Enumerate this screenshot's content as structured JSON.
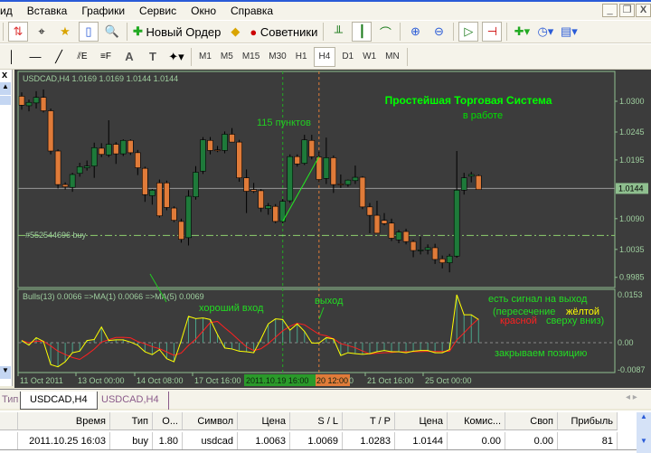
{
  "menu": [
    "ид",
    "Вставка",
    "Графики",
    "Сервис",
    "Окно",
    "Справка"
  ],
  "toolbar": {
    "new_order": "Новый Ордер",
    "experts": "Советники"
  },
  "timeframes": [
    "M1",
    "M5",
    "M15",
    "M30",
    "H1",
    "H4",
    "D1",
    "W1",
    "MN"
  ],
  "active_timeframe": "H4",
  "chart": {
    "header": "USDCAD,H4  1.0169 1.0169 1.0144 1.0144",
    "title": "Простейшая Торговая Система",
    "subtitle": "в работе",
    "points_label": "115 пунктов",
    "order_label": "#552544696 buy",
    "order_price": 1.006,
    "current_price": 1.0144,
    "price_ticks": [
      "1.0300",
      "1.0245",
      "1.0195",
      "1.0144",
      "1.0090",
      "1.0035",
      "0.9985"
    ],
    "price_tick_values": [
      1.03,
      1.0245,
      1.0195,
      1.0144,
      1.009,
      1.0035,
      0.9985
    ],
    "current_price_label": "1.0144",
    "trend_from": {
      "bar": 36,
      "price": 1.0085
    },
    "trend_to": {
      "bar": 41,
      "price": 1.0201
    },
    "entry_bar": 36,
    "exit_bar": 41,
    "candles": [
      [
        1.0309,
        1.0316,
        1.0285,
        1.0293
      ],
      [
        1.0292,
        1.0303,
        1.0282,
        1.0298
      ],
      [
        1.0297,
        1.0318,
        1.0287,
        1.0307
      ],
      [
        1.0307,
        1.0321,
        1.028,
        1.0283
      ],
      [
        1.0283,
        1.0287,
        1.0205,
        1.0211
      ],
      [
        1.0211,
        1.0214,
        1.0144,
        1.0151
      ],
      [
        1.0151,
        1.0155,
        1.0142,
        1.0147
      ],
      [
        1.0146,
        1.0172,
        1.0138,
        1.0169
      ],
      [
        1.0171,
        1.019,
        1.0165,
        1.0183
      ],
      [
        1.0181,
        1.0194,
        1.0176,
        1.0184
      ],
      [
        1.0184,
        1.0226,
        1.0163,
        1.0217
      ],
      [
        1.0216,
        1.0225,
        1.02,
        1.0205
      ],
      [
        1.0204,
        1.0266,
        1.02,
        1.0223
      ],
      [
        1.0223,
        1.0227,
        1.0188,
        1.0206
      ],
      [
        1.0206,
        1.0232,
        1.0202,
        1.023
      ],
      [
        1.023,
        1.0232,
        1.0204,
        1.0208
      ],
      [
        1.0208,
        1.0213,
        1.0168,
        1.0181
      ],
      [
        1.018,
        1.0183,
        1.012,
        1.0133
      ],
      [
        1.0131,
        1.0143,
        1.0115,
        1.0141
      ],
      [
        1.0154,
        1.016,
        1.0092,
        1.0095
      ],
      [
        1.0154,
        1.0158,
        1.0105,
        1.011
      ],
      [
        1.0109,
        1.0112,
        1.0084,
        1.0087
      ],
      [
        1.0085,
        1.009,
        1.0047,
        1.0053
      ],
      [
        1.0056,
        1.0141,
        1.0042,
        1.013
      ],
      [
        1.0129,
        1.0184,
        1.0124,
        1.0173
      ],
      [
        1.0175,
        1.0236,
        1.017,
        1.0231
      ],
      [
        1.023,
        1.0236,
        1.0205,
        1.0212
      ],
      [
        1.0213,
        1.022,
        1.0209,
        1.0212
      ],
      [
        1.0212,
        1.0246,
        1.0207,
        1.0241
      ],
      [
        1.0241,
        1.0252,
        1.023,
        1.0227
      ],
      [
        1.0227,
        1.0231,
        1.0156,
        1.0163
      ],
      [
        1.0163,
        1.0178,
        1.01,
        1.0139
      ],
      [
        1.0142,
        1.0154,
        1.0136,
        1.0139
      ],
      [
        1.014,
        1.0143,
        1.0102,
        1.0109
      ],
      [
        1.0108,
        1.0118,
        1.0097,
        1.0113
      ],
      [
        1.0112,
        1.0116,
        1.0082,
        1.0085
      ],
      [
        1.0085,
        1.0125,
        1.0082,
        1.0121
      ],
      [
        1.0122,
        1.0205,
        1.0118,
        1.0201
      ],
      [
        1.0201,
        1.0205,
        1.0183,
        1.0188
      ],
      [
        1.0189,
        1.024,
        1.0186,
        1.0231
      ],
      [
        1.023,
        1.024,
        1.0196,
        1.0201
      ],
      [
        1.02,
        1.021,
        1.0155,
        1.016
      ],
      [
        1.0162,
        1.0235,
        1.0152,
        1.0199
      ],
      [
        1.0199,
        1.0203,
        1.0136,
        1.0151
      ],
      [
        1.0152,
        1.0169,
        1.0145,
        1.0151
      ],
      [
        1.0151,
        1.016,
        1.0147,
        1.0159
      ],
      [
        1.0158,
        1.0185,
        1.0152,
        1.0164
      ],
      [
        1.0164,
        1.0166,
        1.0107,
        1.0111
      ],
      [
        1.0111,
        1.0118,
        1.0064,
        1.0096
      ],
      [
        1.0096,
        1.0122,
        1.0064,
        1.0064
      ],
      [
        1.0087,
        1.01,
        1.0078,
        1.0081
      ],
      [
        1.0082,
        1.009,
        1.005,
        1.0055
      ],
      [
        1.0052,
        1.007,
        1.0046,
        1.0066
      ],
      [
        1.0067,
        1.0072,
        1.0044,
        1.0049
      ],
      [
        1.0049,
        1.0052,
        1.0021,
        1.0033
      ],
      [
        1.0034,
        1.0058,
        1.0026,
        1.0034
      ],
      [
        1.0034,
        1.0044,
        1.0026,
        1.0038
      ],
      [
        1.0038,
        1.0045,
        1.0009,
        1.0017
      ],
      [
        1.0018,
        1.0024,
        1.0001,
        1.0011
      ],
      [
        1.0011,
        1.0027,
        0.9994,
        1.0023
      ],
      [
        1.0023,
        1.0211,
        1.002,
        1.0141
      ],
      [
        1.0141,
        1.0172,
        1.0133,
        1.0163
      ],
      [
        1.0166,
        1.0174,
        1.0155,
        1.0169
      ],
      [
        1.0167,
        1.0169,
        1.0142,
        1.0142
      ]
    ]
  },
  "indicator": {
    "header": "Bulls(13) 0.0066  =>MA(1) 0.0066  =>MA(5) 0.0069",
    "ticks": [
      "0.0153",
      "0.00",
      "-0.0087"
    ],
    "tick_values": [
      0.0153,
      0,
      -0.0087
    ],
    "good_entry": "хороший вход",
    "exit": "выход",
    "signal": "есть сигнал на выход",
    "crossing_open": "(пересечение",
    "yellow_word": "жёлтой",
    "red_word": "красной",
    "crossing_close": "сверху вниз)",
    "close_position": "закрываем позицию",
    "bulls": [
      0.0007,
      -0.0008,
      0.0016,
      0.0004,
      -0.007,
      -0.0077,
      -0.0061,
      -0.0032,
      -0.0027,
      0.0007,
      0.001,
      0.005,
      0.0007,
      0.0009,
      0.0009,
      0.0002,
      -0.0008,
      -0.0029,
      -0.0038,
      -0.0022,
      -0.0051,
      -0.0061,
      0.0007,
      0.0084,
      0.0077,
      0.0079,
      0.0074,
      0.0026,
      -0.0017,
      -0.002,
      -0.0027,
      -0.0029,
      -0.0032,
      0.0012,
      0.006,
      0.0076,
      0.0074,
      0.004,
      0.006,
      0.0036,
      -0.0001,
      -0.0001,
      0.0016,
      0.0012,
      -0.0041,
      -0.0032,
      -0.0035,
      -0.0037,
      -0.0035,
      -0.0029,
      -0.0025,
      -0.0029,
      -0.0029,
      -0.0032,
      -0.0027,
      -0.0025,
      -0.0025,
      -0.0032,
      -0.0032,
      -0.0022,
      0.0153,
      0.0089,
      0.0089,
      0.0074
    ],
    "ma_period": 5
  },
  "time_axis": [
    "11 Oct 2011",
    "13 Oct 00:00",
    "14 Oct 08:00",
    "17 Oct 16:00",
    "2011.10.19 16:00",
    "20 12:00",
    "0",
    "21 Oct 16:00",
    "25 Oct 00:00"
  ],
  "tabs": [
    "Тип",
    "USDCAD,H4",
    "USDCAD,H4"
  ],
  "table": {
    "headers": [
      "Время",
      "Тип",
      "О...",
      "Символ",
      "Цена",
      "S / L",
      "T / P",
      "Цена",
      "Комис...",
      "Своп",
      "Прибыль"
    ],
    "rows": [
      [
        "2011.10.25 16:03",
        "buy",
        "1.80",
        "usdcad",
        "1.0063",
        "1.0069",
        "1.0283",
        "1.0144",
        "0.00",
        "0.00",
        "81"
      ]
    ]
  },
  "colors": {
    "bull": "#1e7a3a",
    "bear": "#e07b39",
    "bg": "#3c3c3c",
    "text_green": "#00ff00",
    "yellow": "#ffff00",
    "red": "#ff0000"
  }
}
